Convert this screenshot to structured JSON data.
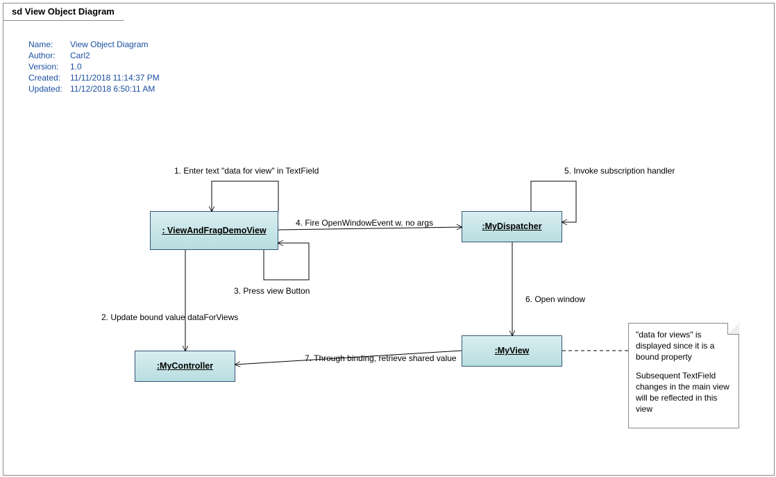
{
  "frame_title": "sd View Object Diagram",
  "meta": {
    "labels": {
      "name": "Name:",
      "author": "Author:",
      "version": "Version:",
      "created": "Created:",
      "updated": "Updated:"
    },
    "name": "View Object Diagram",
    "author": "Carl2",
    "version": "1.0",
    "created": "11/11/2018 11:14:37 PM",
    "updated": "11/12/2018 6:50:11 AM"
  },
  "objects": {
    "viewdemo": ": ViewAndFragDemoView",
    "dispatcher": ":MyDispatcher",
    "controller": ":MyController",
    "myview": ":MyView"
  },
  "messages": {
    "m1": "1. Enter text \"data for view\" in TextField",
    "m2": "2. Update bound value dataForViews",
    "m3": "3. Press view Button",
    "m4": "4. Fire OpenWindowEvent w. no args",
    "m5": "5. Invoke subscription handler",
    "m6": "6. Open window",
    "m7": "7. Through binding, retrieve shared value"
  },
  "note": {
    "p1": "\"data for views\" is displayed since it is a bound property",
    "p2": "Subsequent TextField changes in the main view will be reflected in this view"
  }
}
